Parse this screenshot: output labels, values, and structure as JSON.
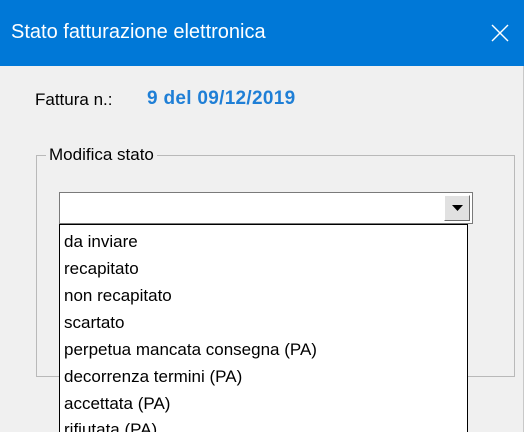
{
  "window": {
    "title": "Stato fatturazione elettronica",
    "close_icon": "close-icon",
    "title_bar_color": "#0078d7"
  },
  "invoice": {
    "label": "Fattura n.:",
    "value": "9 del 09/12/2019",
    "value_color": "#1f7fd6"
  },
  "status_group": {
    "legend": "Modifica stato",
    "combo": {
      "selected_value": "",
      "arrow_icon": "dropdown-arrow-icon"
    },
    "options": [
      "da inviare",
      "recapitato",
      "non recapitato",
      "scartato",
      "perpetua mancata consegna (PA)",
      "decorrenza termini (PA)",
      "accettata (PA)",
      "rifiutata (PA)"
    ]
  }
}
